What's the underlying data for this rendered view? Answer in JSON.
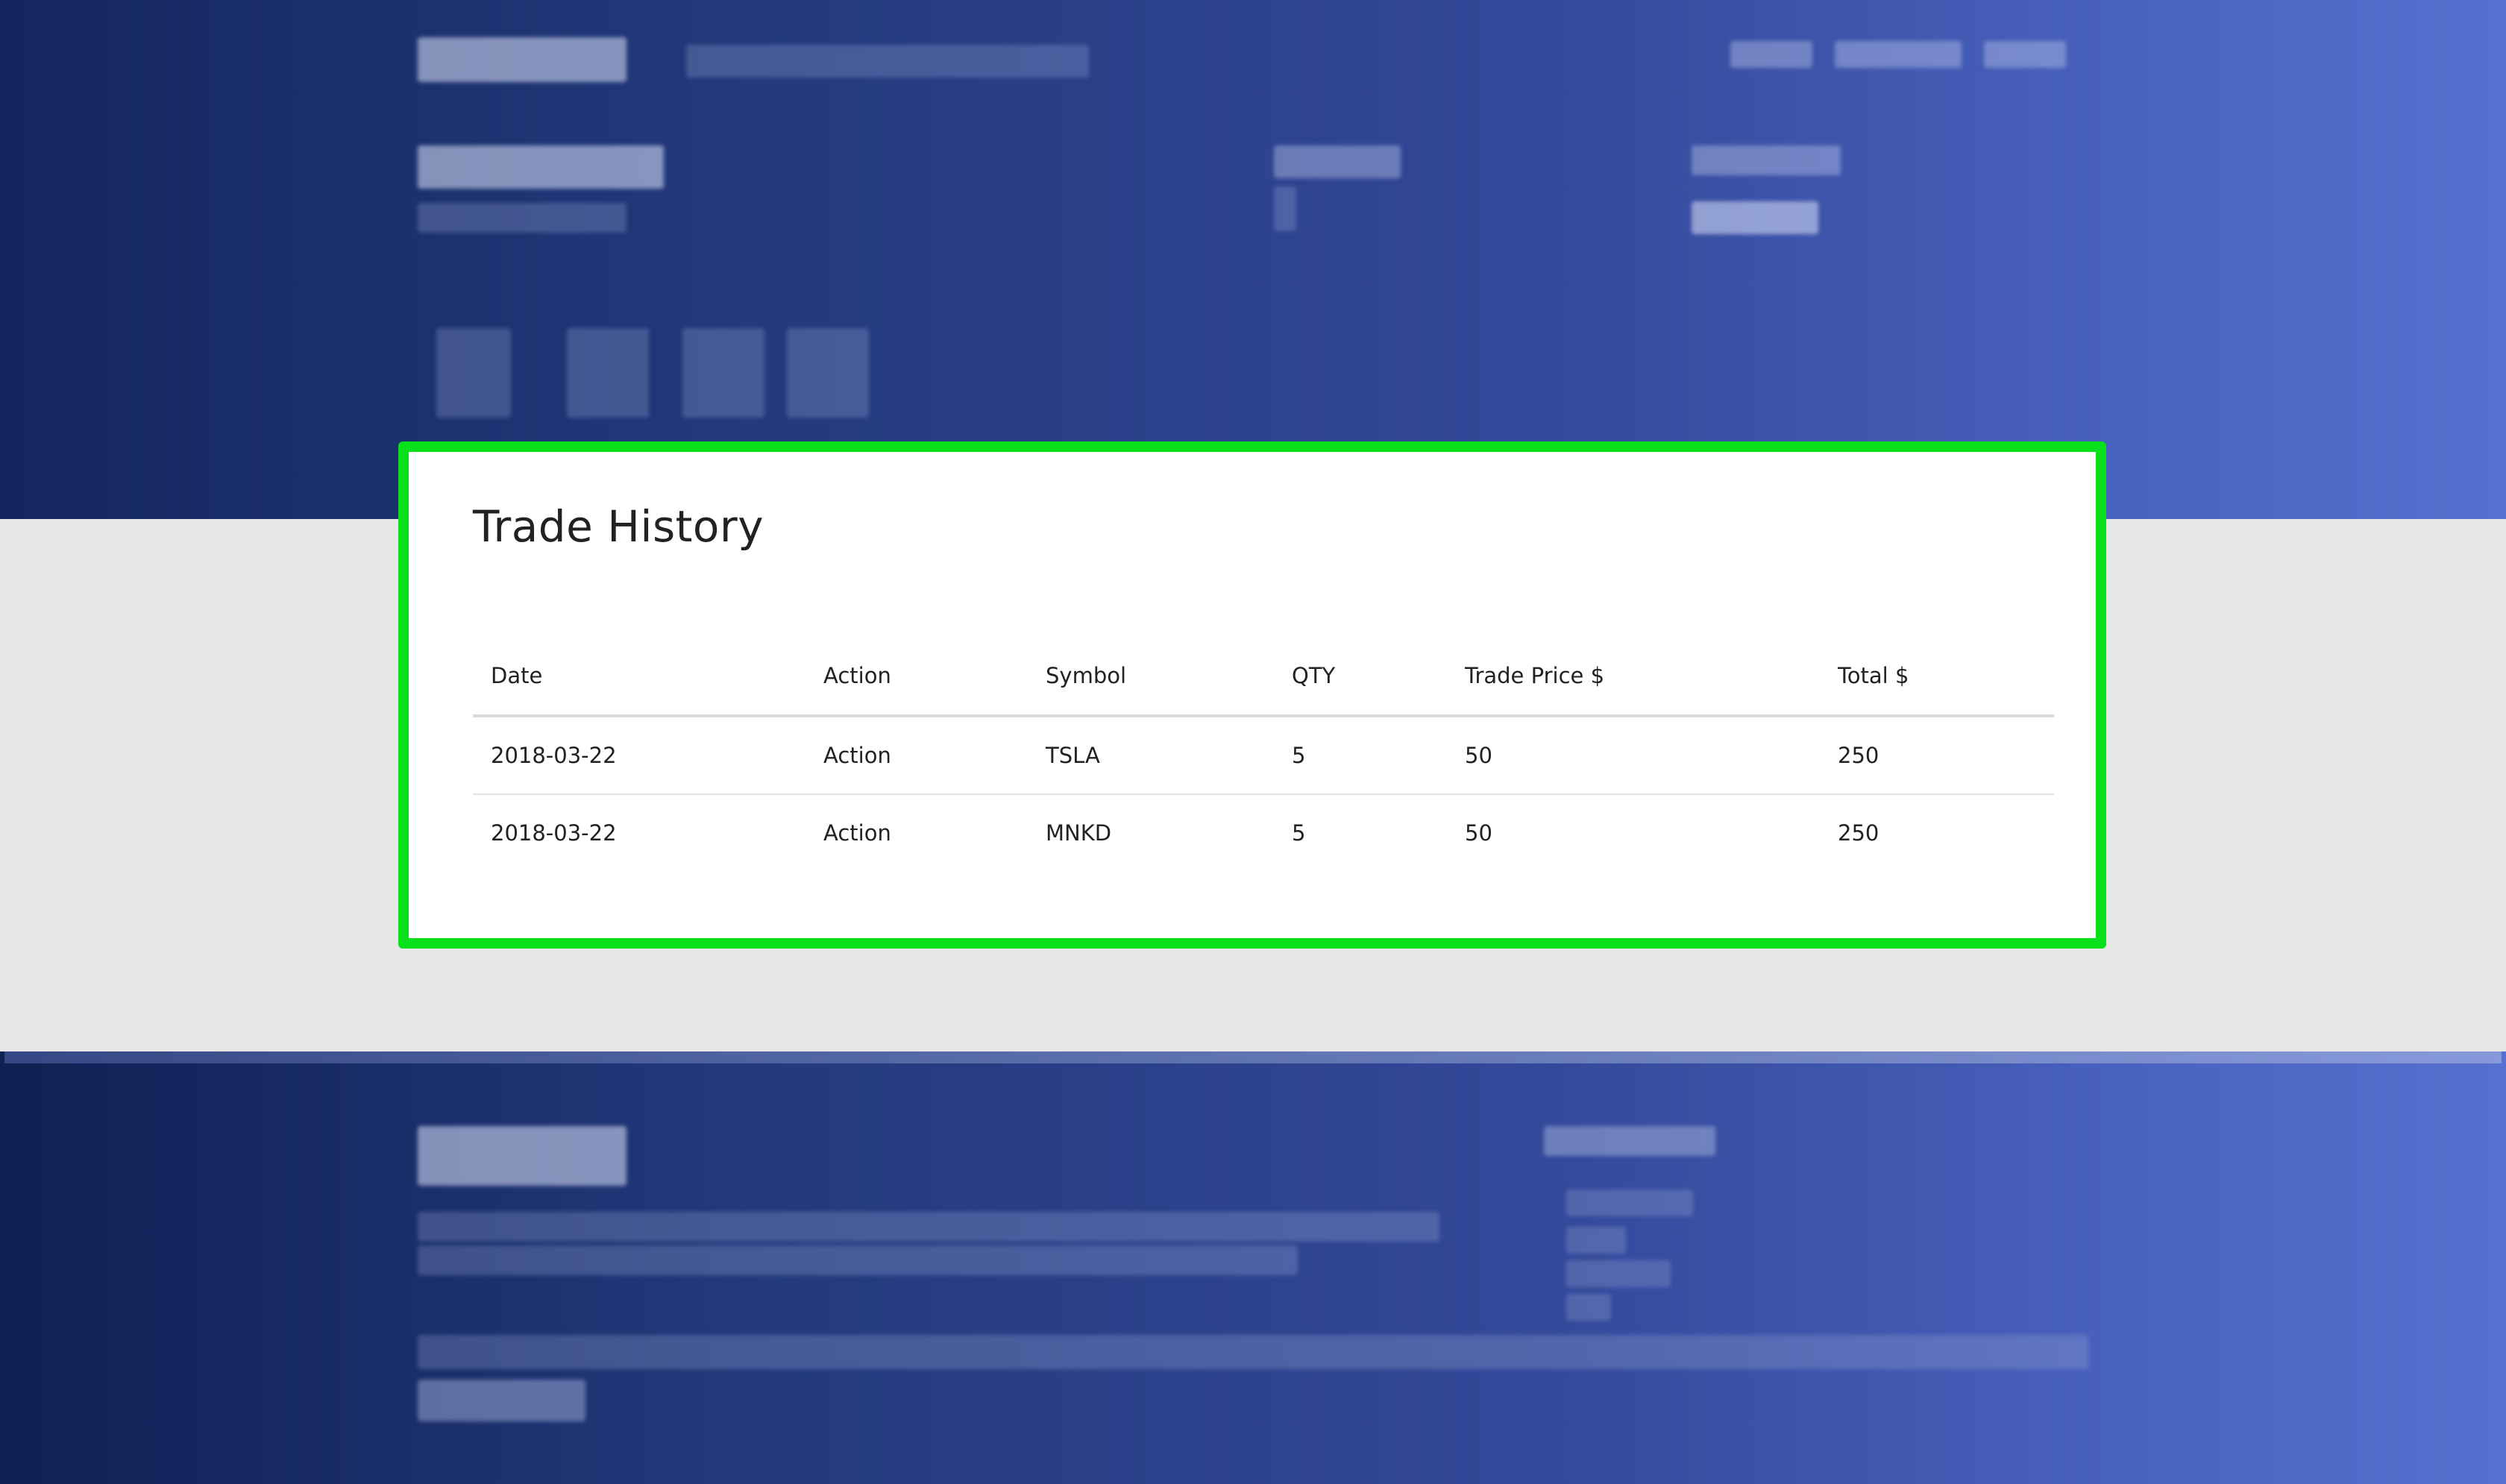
{
  "trade_history": {
    "title": "Trade History",
    "columns": [
      "Date",
      "Action",
      "Symbol",
      "QTY",
      "Trade Price $",
      "Total $"
    ],
    "rows": [
      [
        "2018-03-22",
        "Action",
        "TSLA",
        "5",
        "50",
        "250"
      ],
      [
        "2018-03-22",
        "Action",
        "MNKD",
        "5",
        "50",
        "250"
      ]
    ]
  },
  "colors": {
    "panel_highlight": "#08e01b",
    "hero_gradient_start": "#14265e",
    "hero_gradient_end": "#5670cf",
    "page_background": "#e6e6e6"
  }
}
